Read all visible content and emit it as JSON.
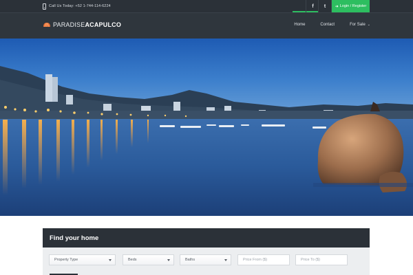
{
  "topbar": {
    "phone_text": "Call Us Today: +52 1-744-114-6224",
    "facebook_label": "f",
    "twitter_label": "t",
    "login_label": "Login / Register"
  },
  "brand": {
    "name_light": "PARADISE",
    "name_bold": "ACAPULCO"
  },
  "nav": {
    "items": [
      {
        "label": "Home"
      },
      {
        "label": "Contact"
      },
      {
        "label": "For Sale"
      }
    ]
  },
  "search": {
    "heading": "Find your home",
    "property_type": "Property Type",
    "beds": "Beds",
    "baths": "Baths",
    "price_from_placeholder": "Price From ($)",
    "price_to_placeholder": "Price To ($)"
  },
  "colors": {
    "dark": "#2b3138",
    "accent": "#2dbe60"
  }
}
